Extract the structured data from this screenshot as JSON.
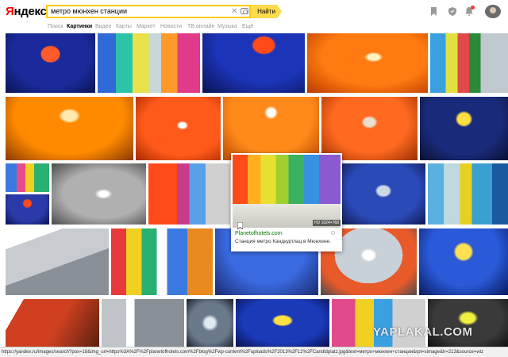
{
  "header": {
    "logo_first": "Я",
    "logo_rest": "ндекс",
    "search": {
      "value": "метро мюнхен станции",
      "placeholder": ""
    },
    "search_button": "Найти",
    "icons": [
      "bookmark-icon",
      "shield-icon",
      "bell-icon",
      "avatar"
    ]
  },
  "nav": {
    "items": [
      {
        "label": "Поиск",
        "active": false
      },
      {
        "label": "Картинки",
        "active": true
      },
      {
        "label": "Видео",
        "active": false
      },
      {
        "label": "Карты",
        "active": false
      },
      {
        "label": "Маркет",
        "active": false
      },
      {
        "label": "Новости",
        "active": false
      },
      {
        "label": "ТВ онлайн",
        "active": false
      },
      {
        "label": "Музыка",
        "active": false
      },
      {
        "label": "Ещё",
        "active": false
      }
    ]
  },
  "preview": {
    "size": "HD 1024×768",
    "site": "Planetofhotels.com",
    "caption": "Станция метро Кандидплац в Мюнхене."
  },
  "watermark": "YAPLAKAL.COM",
  "status_url": "https://yandex.ru/images/search?pos=18&img_url=https%3A%2F%2Fplanetofhotels.com%2Fblog%2Fwp-content%2Fuploads%2F2013%2F12%2FCandidplatz.jpg&text=метро+мюнхен+станции&rpt=simage&lr=213&source=wiz",
  "colors": {
    "accent": "#ffdb4d",
    "search_border": "#ffcc00",
    "logo_red": "#ff0000"
  }
}
